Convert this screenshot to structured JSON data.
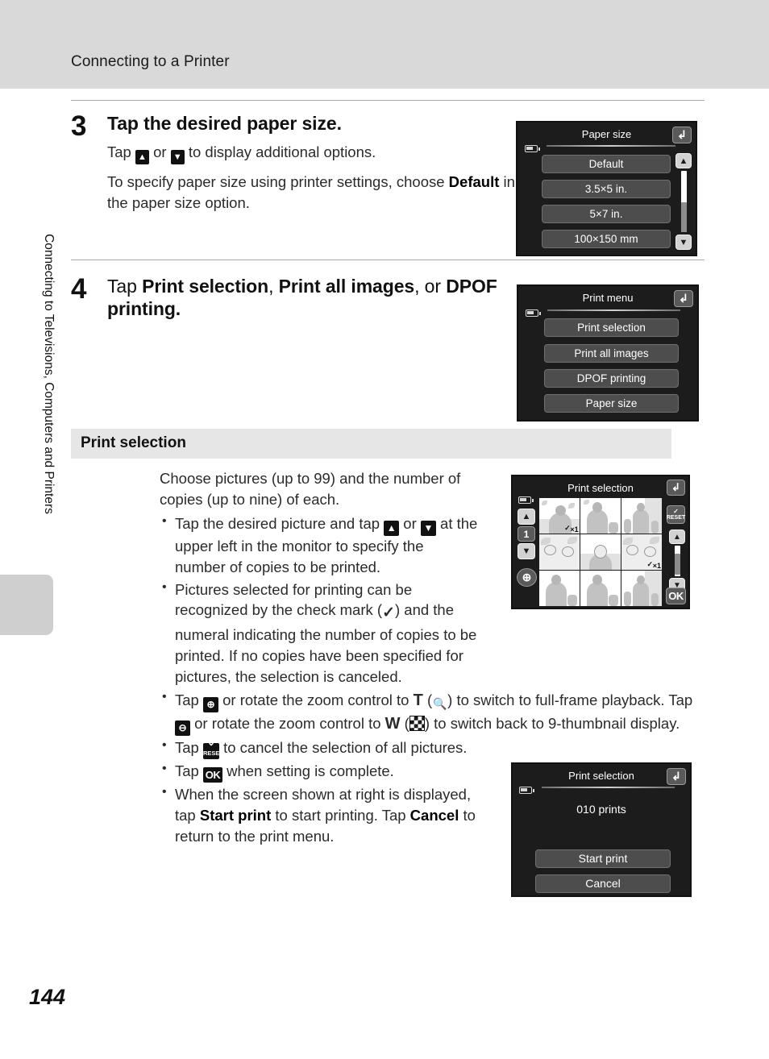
{
  "header": {
    "title": "Connecting to a Printer"
  },
  "sidebar": {
    "vertical_label": "Connecting to Televisions, Computers and Printers"
  },
  "footer": {
    "page_number": "144"
  },
  "steps": [
    {
      "number": "3",
      "title": "Tap the desired paper size.",
      "para1_pre": "Tap ",
      "para1_mid": " or ",
      "para1_post": " to display additional options.",
      "para2_pre": "To specify paper size using printer settings, choose ",
      "para2_bold": "Default",
      "para2_post": " in the paper size option."
    },
    {
      "number": "4",
      "title_pre": "Tap ",
      "title_b1": "Print selection",
      "title_sep1": ", ",
      "title_b2": "Print all images",
      "title_sep2": ", or ",
      "title_b3": "DPOF printing",
      "title_end": "."
    }
  ],
  "section": {
    "heading": "Print selection",
    "intro": "Choose pictures (up to 99) and the number of copies (up to nine) of each.",
    "bullets": {
      "b1_a": "Tap the desired picture and tap ",
      "b1_b": " or ",
      "b1_c": " at the upper left in the monitor to specify the number of copies to be printed.",
      "b2_a": "Pictures selected for printing can be recognized by the check mark (",
      "b2_b": ") and the numeral indicating the number of copies to be printed. If no copies have been specified for pictures, the selection is canceled.",
      "b3_a": "Tap ",
      "b3_b": " or rotate the zoom control to ",
      "b3_T": "T",
      "b3_c": " (",
      "b3_d": ") to switch to full-frame playback. Tap ",
      "b3_e": " or rotate the zoom control to ",
      "b3_W": "W",
      "b3_f": " (",
      "b3_g": ") to switch back to 9-thumbnail display.",
      "b4_a": "Tap ",
      "b4_b": " to cancel the selection of all pictures.",
      "b5_a": "Tap ",
      "b5_b": " when setting is complete.",
      "b6_a": "When the screen shown at right is displayed, tap ",
      "b6_bold1": "Start print",
      "b6_b": " to start printing. Tap ",
      "b6_bold2": "Cancel",
      "b6_c": " to return to the print menu."
    }
  },
  "screens": {
    "paper_size": {
      "title": "Paper size",
      "items": [
        "Default",
        "3.5×5 in.",
        "5×7 in.",
        "100×150 mm"
      ],
      "back_icon": "back-arrow-icon",
      "up_icon": "scroll-up-icon",
      "down_icon": "scroll-down-icon",
      "battery_icon": "battery-icon"
    },
    "print_menu": {
      "title": "Print menu",
      "items": [
        "Print selection",
        "Print all images",
        "DPOF printing",
        "Paper size"
      ],
      "back_icon": "back-arrow-icon",
      "battery_icon": "battery-icon"
    },
    "print_selection_grid": {
      "title": "Print selection",
      "copy_counter": "1",
      "reset_label": "RESET",
      "ok_label": "OK",
      "zoom_icon": "zoom-in-icon",
      "up_icon": "increase-copies-icon",
      "down_icon": "decrease-copies-icon",
      "back_icon": "back-arrow-icon",
      "thumbnails": [
        {
          "qty": "×1",
          "selected": true
        },
        {
          "qty": "",
          "selected": false
        },
        {
          "qty": "",
          "selected": false
        },
        {
          "qty": "",
          "selected": false
        },
        {
          "qty": "",
          "selected": false
        },
        {
          "qty": "×1",
          "selected": true
        },
        {
          "qty": "",
          "selected": false
        },
        {
          "qty": "",
          "selected": false
        },
        {
          "qty": "",
          "selected": false
        }
      ]
    },
    "print_confirm": {
      "title": "Print selection",
      "count_text": "010 prints",
      "start_label": "Start print",
      "cancel_label": "Cancel",
      "back_icon": "back-arrow-icon",
      "battery_icon": "battery-icon"
    }
  },
  "colors": {
    "header_band": "#d9d9d9",
    "section_bar": "#e6e6e6",
    "screen_bg": "#1c1c1c",
    "menu_item": "#4d4d4d"
  }
}
